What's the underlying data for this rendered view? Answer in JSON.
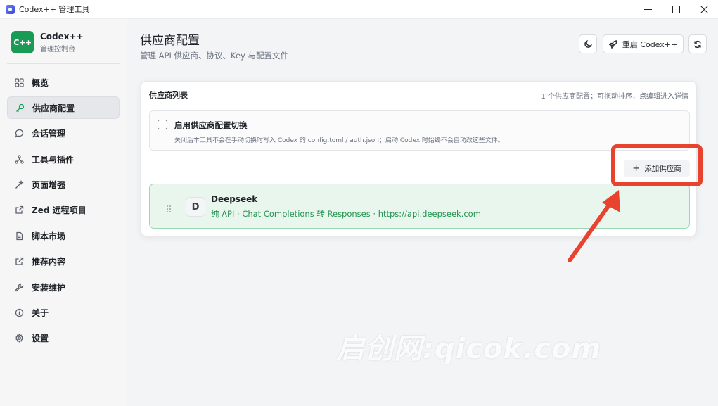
{
  "window": {
    "title": "Codex++ 管理工具"
  },
  "brand": {
    "logo_text": "C++",
    "name": "Codex++",
    "subtitle": "管理控制台"
  },
  "sidebar": {
    "items": [
      {
        "label": "概览",
        "icon": "grid-icon",
        "active": false
      },
      {
        "label": "供应商配置",
        "icon": "key-icon",
        "active": true
      },
      {
        "label": "会话管理",
        "icon": "chat-icon",
        "active": false
      },
      {
        "label": "工具与插件",
        "icon": "plugin-icon",
        "active": false
      },
      {
        "label": "页面增强",
        "icon": "wand-icon",
        "active": false
      },
      {
        "label": "Zed 远程项目",
        "icon": "external-link-icon",
        "active": false
      },
      {
        "label": "脚本市场",
        "icon": "script-icon",
        "active": false
      },
      {
        "label": "推荐内容",
        "icon": "external-link-icon",
        "active": false
      },
      {
        "label": "安装维护",
        "icon": "wrench-icon",
        "active": false
      },
      {
        "label": "关于",
        "icon": "info-icon",
        "active": false
      },
      {
        "label": "设置",
        "icon": "gear-icon",
        "active": false
      }
    ]
  },
  "header": {
    "title": "供应商配置",
    "subtitle": "管理 API 供应商、协议、Key 与配置文件",
    "restart_label": "重启 Codex++"
  },
  "panel": {
    "title": "供应商列表",
    "hint": "1 个供应商配置；可拖动排序，点编辑进入详情",
    "toggle_label": "启用供应商配置切换",
    "toggle_desc": "关闭后本工具不会在手动切换时写入 Codex 的 config.toml / auth.json；启动 Codex 时始终不会自动改这些文件。",
    "toggle_checked": false,
    "add_label": "添加供应商"
  },
  "providers": [
    {
      "avatar": "D",
      "name": "Deepseek",
      "detail": "纯 API · Chat Completions 转 Responses · https://api.deepseek.com"
    }
  ],
  "watermark": "启创网:qicok.com",
  "colors": {
    "accent": "#1a9b55",
    "provider_bg": "#e9f6ee",
    "annotation": "#e8432e"
  }
}
